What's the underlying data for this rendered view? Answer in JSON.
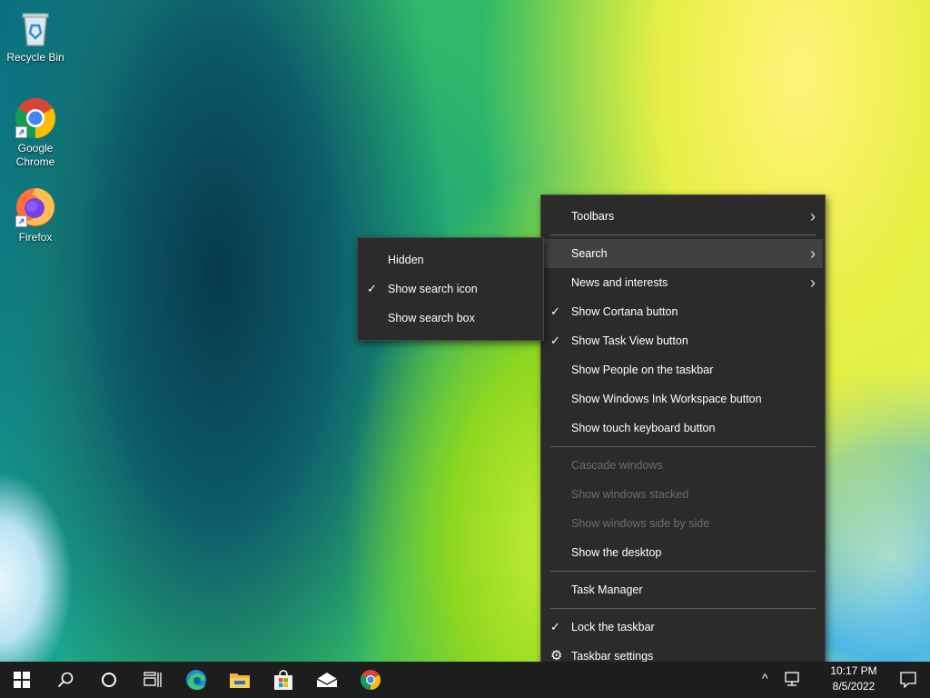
{
  "desktop_icons": [
    {
      "label": "Recycle Bin",
      "icon": "recycle-bin-icon"
    },
    {
      "label": "Google Chrome",
      "icon": "chrome-icon"
    },
    {
      "label": "Firefox",
      "icon": "firefox-icon"
    }
  ],
  "context_menu": {
    "items": [
      {
        "label": "Toolbars",
        "submenu": true
      },
      {
        "label": "Search",
        "submenu": true,
        "highlighted": true
      },
      {
        "label": "News and interests",
        "submenu": true
      },
      {
        "label": "Show Cortana button",
        "checked": true
      },
      {
        "label": "Show Task View button",
        "checked": true
      },
      {
        "label": "Show People on the taskbar"
      },
      {
        "label": "Show Windows Ink Workspace button"
      },
      {
        "label": "Show touch keyboard button"
      },
      {
        "label": "Cascade windows",
        "disabled": true
      },
      {
        "label": "Show windows stacked",
        "disabled": true
      },
      {
        "label": "Show windows side by side",
        "disabled": true
      },
      {
        "label": "Show the desktop"
      },
      {
        "label": "Task Manager"
      },
      {
        "label": "Lock the taskbar",
        "checked": true
      },
      {
        "label": "Taskbar settings",
        "icon": "gear-icon"
      }
    ]
  },
  "search_submenu": {
    "items": [
      {
        "label": "Hidden"
      },
      {
        "label": "Show search icon",
        "checked": true
      },
      {
        "label": "Show search box"
      }
    ]
  },
  "taskbar": {
    "buttons": [
      "start-button",
      "search-button",
      "cortana-button",
      "task-view-button",
      "edge-button",
      "file-explorer-button",
      "store-button",
      "mail-button",
      "chrome-button"
    ],
    "time": "10:17 PM",
    "date": "8/5/2022"
  },
  "colors": {
    "menu_bg": "#2b2b2b",
    "menu_highlight": "#414141",
    "taskbar_bg": "#1d1d1d",
    "disabled_text": "#6e6e6e"
  }
}
